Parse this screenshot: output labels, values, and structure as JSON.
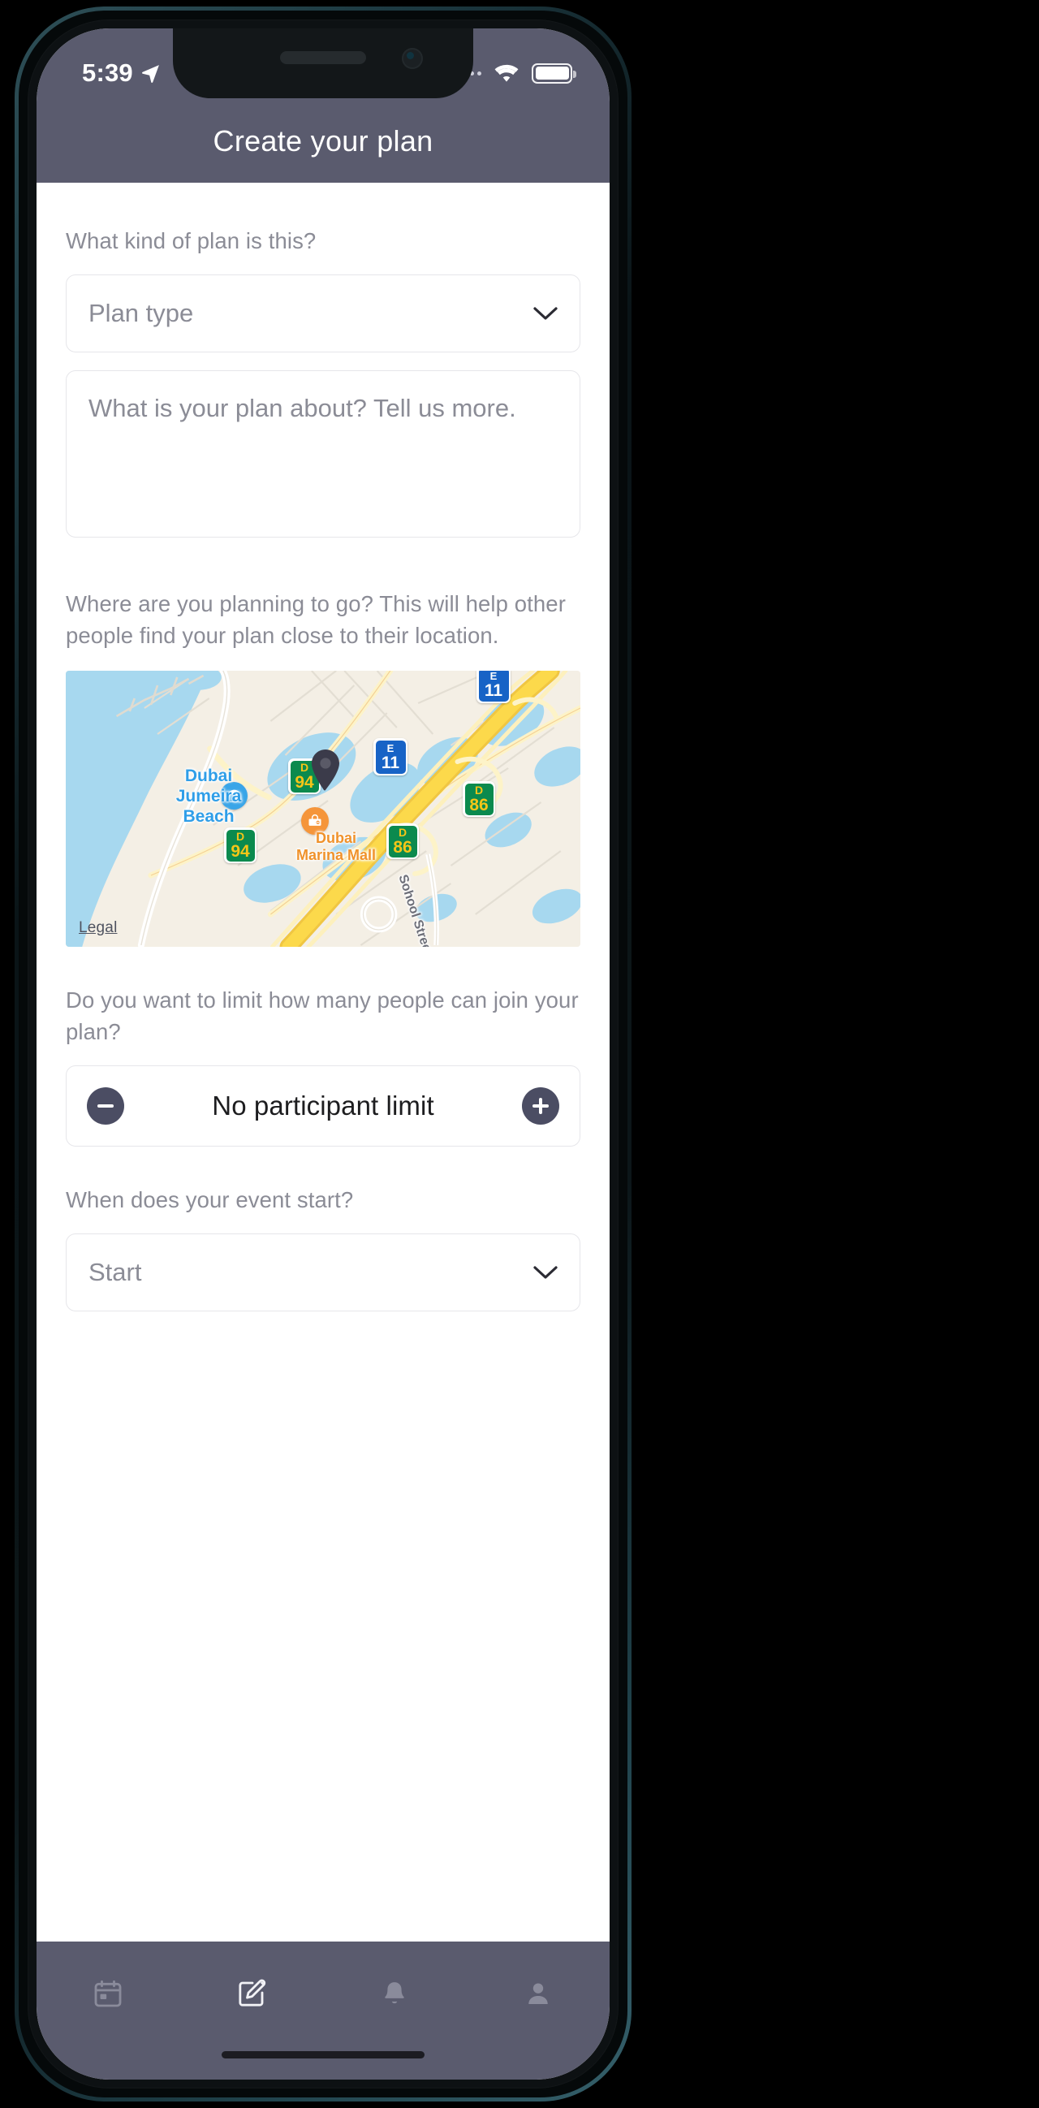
{
  "status_bar": {
    "time": "5:39",
    "location_icon": "location-arrow-icon",
    "cellular_icon": "cellular-dots-icon",
    "wifi_icon": "wifi-icon",
    "battery_icon": "battery-full-icon"
  },
  "header": {
    "title": "Create your plan"
  },
  "form": {
    "plan_type_label": "What kind of plan is this?",
    "plan_type_value": "Plan type",
    "plan_type_chevron": "chevron-down-icon",
    "description_placeholder": "What is your plan about? Tell us more.",
    "location_label": "Where are you planning to go? This will help other people find your plan close to their location.",
    "participants_label": "Do you want to limit how many people can join your plan?",
    "participants_value": "No participant limit",
    "decrement_icon": "minus-circle-icon",
    "increment_icon": "plus-circle-icon",
    "start_label": "When does your event start?",
    "start_value": "Start",
    "start_chevron": "chevron-down-icon"
  },
  "map": {
    "legal_link": "Legal",
    "pin_icon": "map-pin-icon",
    "labels": [
      {
        "text": "Dubai",
        "kind": "beach"
      },
      {
        "text": "Jumeira",
        "kind": "beach"
      },
      {
        "text": "Beach",
        "kind": "beach"
      },
      {
        "text": "Dubai",
        "kind": "mall"
      },
      {
        "text": "Marina Mall",
        "kind": "mall"
      },
      {
        "text": "Sohool Street",
        "kind": "street"
      }
    ],
    "beach_label": "Dubai\nJumeira\nBeach",
    "mall_label": "Dubai\nMarina Mall",
    "street_label": "Sohool Street",
    "beach_poi_icon": "beach-umbrella-icon",
    "mall_poi_icon": "shopping-mall-icon",
    "shields": [
      {
        "prefix": "D",
        "number": "94",
        "color": "green"
      },
      {
        "prefix": "D",
        "number": "94",
        "color": "green"
      },
      {
        "prefix": "E",
        "number": "11",
        "color": "blue"
      },
      {
        "prefix": "D",
        "number": "86",
        "color": "green"
      },
      {
        "prefix": "D",
        "number": "86",
        "color": "green"
      },
      {
        "prefix": "E",
        "number": "11",
        "color": "blue"
      }
    ],
    "colors": {
      "water": "#a7d8ef",
      "land": "#f4efe5",
      "motorway": "#fcd94b",
      "road": "#fdf3c8",
      "beach_text": "#2f9ee8",
      "mall_text": "#f0922b"
    }
  },
  "tab_bar": {
    "items": [
      {
        "name": "calendar-icon",
        "label": "Calendar"
      },
      {
        "name": "compose-icon",
        "label": "Create"
      },
      {
        "name": "bell-icon",
        "label": "Notifications"
      },
      {
        "name": "person-icon",
        "label": "Profile"
      }
    ]
  },
  "theme": {
    "chrome": "#5a5b6e",
    "label_gray": "#8b8c96",
    "border": "#e6e6ea",
    "value_dark": "#1d1d1f",
    "stepper_btn": "#4b4d63"
  }
}
